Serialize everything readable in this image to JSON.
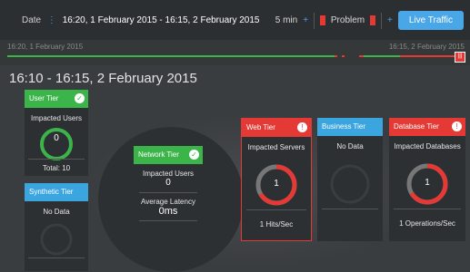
{
  "topbar": {
    "date_label": "Date",
    "date_range": "16:20, 1 February 2015 - 16:15, 2 February 2015",
    "interval": "5 min",
    "problem_label": "Problem",
    "live_button": "Live Traffic"
  },
  "timeline": {
    "start": "16:20, 1 February 2015",
    "end": "16:15, 2 February 2015"
  },
  "window_title": "16:10 - 16:15, 2 February 2015",
  "tiers": {
    "user": {
      "name": "User Tier",
      "label": "Impacted Users",
      "value": "0",
      "total": "Total: 10"
    },
    "synthetic": {
      "name": "Synthetic Tier",
      "label": "No Data"
    },
    "network": {
      "name": "Network Tier",
      "label": "Impacted Users",
      "value": "0",
      "latency_label": "Average Latency",
      "latency": "0ms"
    },
    "web": {
      "name": "Web Tier",
      "label": "Impacted Servers",
      "value": "1",
      "footer": "1 Hits/Sec"
    },
    "business": {
      "name": "Business Tier",
      "label": "No Data"
    },
    "database": {
      "name": "Database Tier",
      "label": "Impacted Databases",
      "value": "1",
      "footer": "1 Operations/Sec"
    }
  },
  "colors": {
    "ok": "#3bb54a",
    "info": "#3aa5df",
    "alert": "#e53935",
    "live": "#49a6e7"
  },
  "icons": [
    "check-icon",
    "alert-icon",
    "plus-icon",
    "timeline-marker-icon"
  ]
}
